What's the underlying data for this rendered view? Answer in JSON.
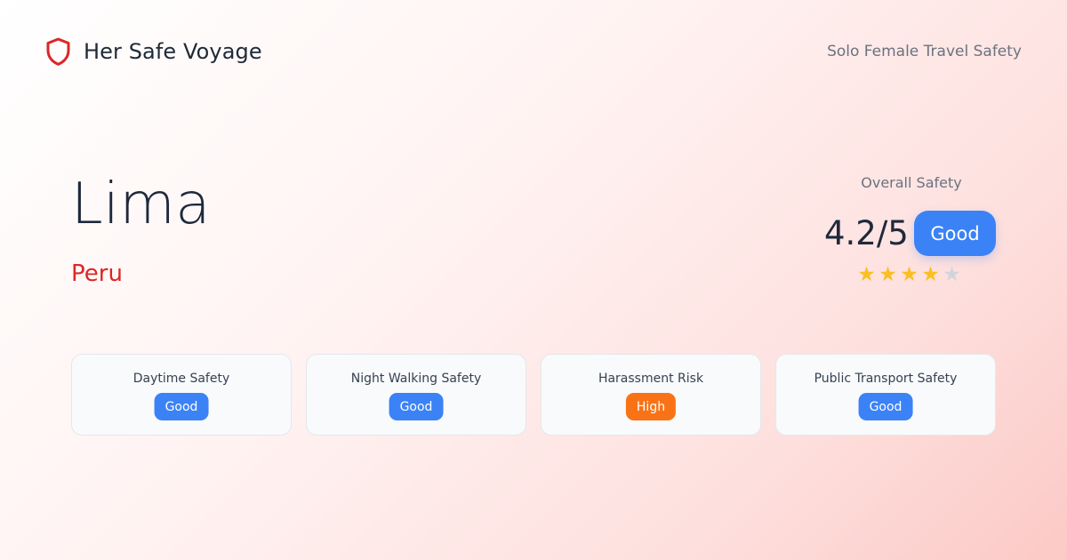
{
  "header": {
    "brand_name": "Her Safe Voyage",
    "logo_icon": "shield-icon",
    "tagline": "Solo Female Travel Safety"
  },
  "location": {
    "city": "Lima",
    "country": "Peru"
  },
  "overall": {
    "label": "Overall Safety",
    "score_text": "4.2/5",
    "score": 4.2,
    "max_score": 5,
    "rating": "Good",
    "stars_filled": 4,
    "stars_total": 5
  },
  "metrics": [
    {
      "label": "Daytime Safety",
      "rating": "Good"
    },
    {
      "label": "Night Walking Safety",
      "rating": "Good"
    },
    {
      "label": "Harassment Risk",
      "rating": "High"
    },
    {
      "label": "Public Transport Safety",
      "rating": "Good"
    }
  ],
  "colors": {
    "accent_red": "#dc2626",
    "good": "#3b82f6",
    "high": "#f97316",
    "star_on": "#fbbf24",
    "star_off": "#d1d5db"
  }
}
